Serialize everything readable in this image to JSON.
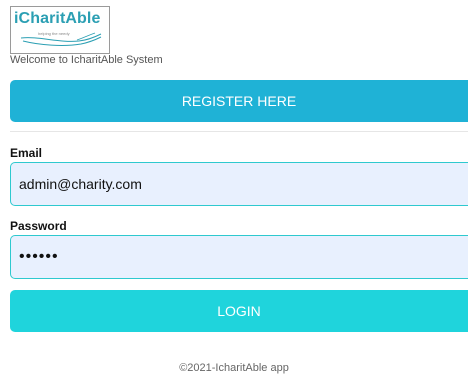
{
  "logo": {
    "brand_text": "iCharitAble",
    "tagline": "helping the needy"
  },
  "header": {
    "welcome_text": "Welcome to IcharitAble System"
  },
  "register": {
    "label": "REGISTER HERE"
  },
  "form": {
    "email_label": "Email",
    "email_value": "admin@charity.com",
    "password_label": "Password",
    "password_value": "••••••"
  },
  "login": {
    "label": "LOGIN"
  },
  "footer": {
    "text": "©2021-IcharitAble app"
  },
  "colors": {
    "register_bg": "#1fb2d6",
    "login_bg": "#1fd4dc",
    "field_bg": "#e8f0fe",
    "field_border": "#2ec9cf"
  },
  "icons": {
    "logo": "hand-holding-icon"
  }
}
